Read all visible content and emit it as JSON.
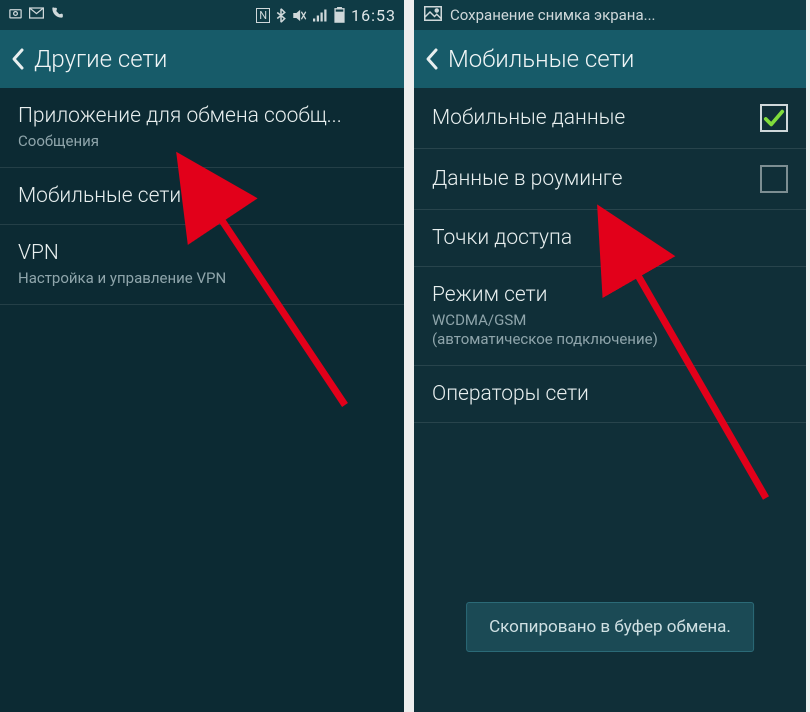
{
  "left": {
    "status": {
      "time": "16:53"
    },
    "header": {
      "title": "Другие сети"
    },
    "items": [
      {
        "title": "Приложение для обмена сообщ...",
        "sub": "Сообщения"
      },
      {
        "title": "Мобильные сети"
      },
      {
        "title": "VPN",
        "sub": "Настройка и управление VPN"
      }
    ]
  },
  "right": {
    "status_notice": "Сохранение снимка экрана...",
    "header": {
      "title": "Мобильные сети"
    },
    "items": [
      {
        "title": "Мобильные данные",
        "checkbox": true,
        "checked": true
      },
      {
        "title": "Данные в роуминге",
        "checkbox": true,
        "checked": false
      },
      {
        "title": "Точки доступа"
      },
      {
        "title": "Режим сети",
        "sub": "WCDMA/GSM\n(автоматическое подключение)"
      },
      {
        "title": "Операторы сети"
      }
    ],
    "toast": "Скопировано в буфер обмена."
  }
}
